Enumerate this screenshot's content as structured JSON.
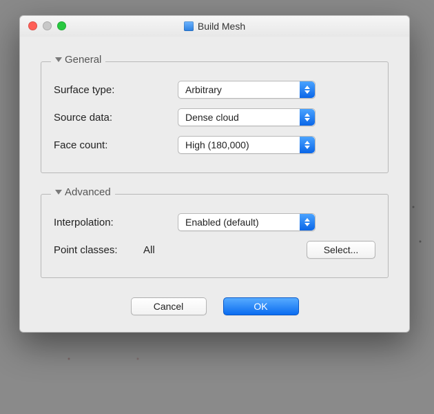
{
  "window": {
    "title": "Build Mesh"
  },
  "groups": {
    "general": {
      "legend": "General",
      "surface_type": {
        "label": "Surface type:",
        "value": "Arbitrary"
      },
      "source_data": {
        "label": "Source data:",
        "value": "Dense cloud"
      },
      "face_count": {
        "label": "Face count:",
        "value": "High (180,000)"
      }
    },
    "advanced": {
      "legend": "Advanced",
      "interpolation": {
        "label": "Interpolation:",
        "value": "Enabled (default)"
      },
      "point_classes": {
        "label": "Point classes:",
        "value": "All",
        "button": "Select..."
      }
    }
  },
  "footer": {
    "cancel": "Cancel",
    "ok": "OK"
  }
}
